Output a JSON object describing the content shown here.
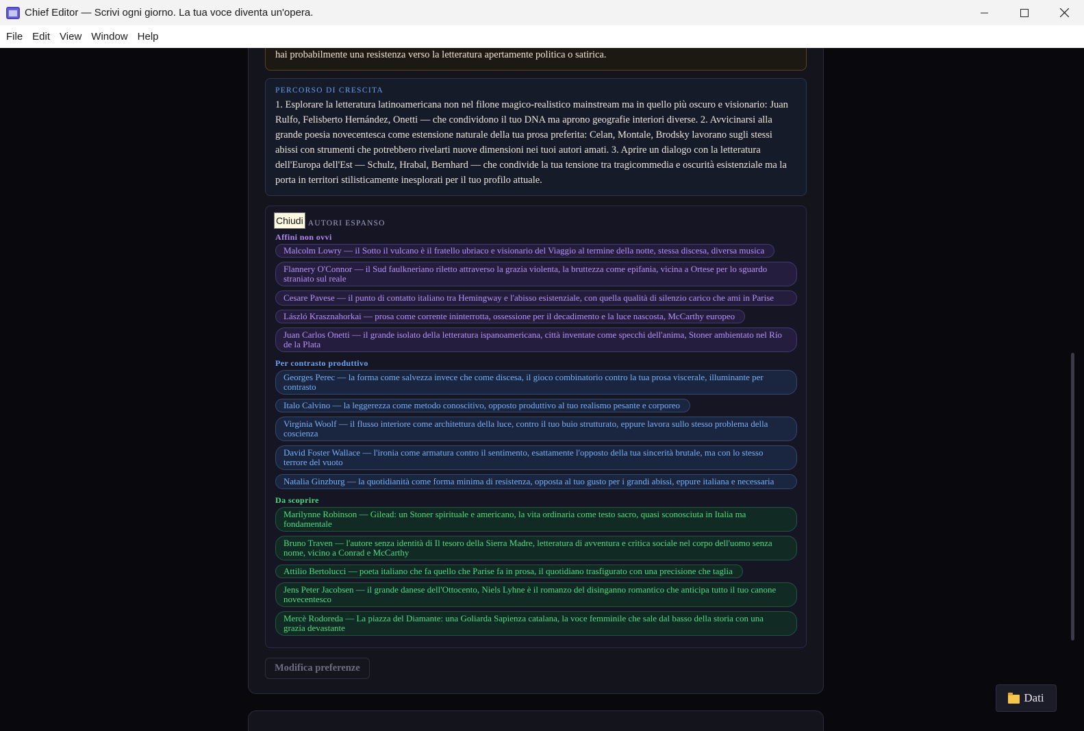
{
  "window": {
    "title": "Chief Editor — Scrivi ogni giorno. La tua voce diventa un'opera."
  },
  "menu": [
    "File",
    "Edit",
    "View",
    "Window",
    "Help"
  ],
  "previous_card": {
    "text": "hai probabilmente una resistenza verso la letteratura apertamente politica o satirica."
  },
  "growth": {
    "label": "PERCORSO DI CRESCITA",
    "text": "1. Esplorare la letteratura latinoamericana non nel filone magico-realistico mainstream ma in quello più oscuro e visionario: Juan Rulfo, Felisberto Hernández, Onetti — che condividono il tuo DNA ma aprono geografie interiori diverse. 2. Avvicinarsi alla grande poesia novecentesca come estensione naturale della tua prosa preferita: Celan, Montale, Brodsky lavorano sugli stessi abissi con strumenti che potrebbero rivelarti nuove dimensioni nei tuoi autori amati. 3. Aprire un dialogo con la letteratura dell'Europa dell'Est — Schulz, Hrabal, Bernhard — che condivide la tua tensione tra tragicommedia e oscurità esistenziale ma la porta in territori stilisticamente inesplorati per il tuo profilo attuale."
  },
  "author_map": {
    "close_label": "Chiudi",
    "title": "AUTORI ESPANSO",
    "groups": [
      {
        "label": "Affini non ovvi",
        "items": [
          "Malcolm Lowry — il Sotto il vulcano è il fratello ubriaco e visionario del Viaggio al termine della notte, stessa discesa, diversa musica",
          "Flannery O'Connor — il Sud faulkneriano riletto attraverso la grazia violenta, la bruttezza come epifania, vicina a Ortese per lo sguardo straniato sul reale",
          "Cesare Pavese — il punto di contatto italiano tra Hemingway e l'abisso esistenziale, con quella qualità di silenzio carico che ami in Parise",
          "László Krasznahorkai — prosa come corrente ininterrotta, ossessione per il decadimento e la luce nascosta, McCarthy europeo",
          "Juan Carlos Onetti — il grande isolato della letteratura ispanoamericana, città inventate come specchi dell'anima, Stoner ambientato nel Río de la Plata"
        ]
      },
      {
        "label": "Per contrasto produttivo",
        "items": [
          "Georges Perec — la forma come salvezza invece che come discesa, il gioco combinatorio contro la tua prosa viscerale, illuminante per contrasto",
          "Italo Calvino — la leggerezza come metodo conoscitivo, opposto produttivo al tuo realismo pesante e corporeo",
          "Virginia Woolf — il flusso interiore come architettura della luce, contro il tuo buio strutturato, eppure lavora sullo stesso problema della coscienza",
          "David Foster Wallace — l'ironia come armatura contro il sentimento, esattamente l'opposto della tua sincerità brutale, ma con lo stesso terrore del vuoto",
          "Natalia Ginzburg — la quotidianità come forma minima di resistenza, opposta al tuo gusto per i grandi abissi, eppure italiana e necessaria"
        ]
      },
      {
        "label": "Da scoprire",
        "items": [
          "Marilynne Robinson — Gilead: un Stoner spirituale e americano, la vita ordinaria come testo sacro, quasi sconosciuta in Italia ma fondamentale",
          "Bruno Traven — l'autore senza identità di Il tesoro della Sierra Madre, letteratura di avventura e critica sociale nel corpo dell'uomo senza nome, vicino a Conrad e McCarthy",
          "Attilio Bertolucci — poeta italiano che fa quello che Parise fa in prosa, il quotidiano trasfigurato con una precisione che taglia",
          "Jens Peter Jacobsen — il grande danese dell'Ottocento, Niels Lyhne è il romanzo del disinganno romantico che anticipa tutto il tuo canone novecentesco",
          "Mercè Rodoreda — La piazza del Diamante: una Goliarda Sapienza catalana, la voce femminile che sale dal basso della storia con una grazia devastante"
        ]
      }
    ]
  },
  "modify_label": "Modifica preferenze",
  "dati_label": "Dati",
  "colors": {
    "affini": "#b794f6",
    "contrasto": "#7ab0f6",
    "scoprire": "#4ddc86"
  }
}
